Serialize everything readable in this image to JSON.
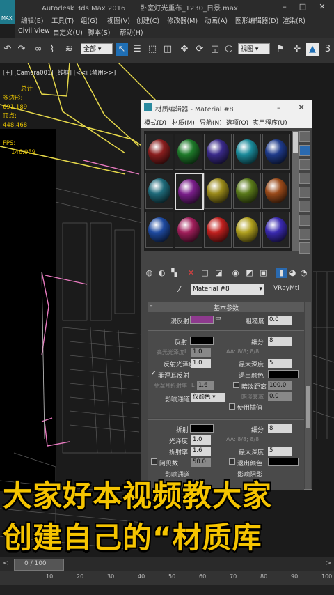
{
  "window": {
    "app_title": "Autodesk 3ds Max 2016",
    "file_title": "卧室灯光重布_1230_日景.max",
    "logo_label": "MAX"
  },
  "menubar": {
    "row1": [
      "编辑(E)",
      "工具(T)",
      "组(G)",
      "视图(V)",
      "创建(C)",
      "修改器(M)",
      "动画(A)",
      "图形编辑器(D)",
      "渲染(R)"
    ],
    "row2": [
      "Civil View",
      "自定义(U)",
      "脚本(S)",
      "帮助(H)"
    ]
  },
  "toolbar": {
    "selection_filter": "全部",
    "view_dropdown": "视图"
  },
  "viewport": {
    "label": "[+] [Camera001] [线框] [<<已禁用>>]",
    "stats_header": "总计",
    "polys_label": "多边形:",
    "polys_value": "691,189",
    "verts_label": "顶点:",
    "verts_value": "448,468",
    "fps_label": "FPS:",
    "fps_value": "146.059"
  },
  "material_editor": {
    "title": "材质编辑器 - Material #8",
    "menu": [
      "模式(D)",
      "材质(M)",
      "导航(N)",
      "选项(O)",
      "实用程序(U)"
    ],
    "slot_colors": [
      [
        "#8a1e1e",
        "#1e7a2a",
        "#3a2a8a",
        "#1a8a9a",
        "#1e3a8a"
      ],
      [
        "#1e6a7a",
        "#7a1e8a",
        "#9a8a1a",
        "#5a7a1a",
        "#9a4a1a"
      ],
      [
        "#1e4aa0",
        "#a01e5a",
        "#c0201e",
        "#b0a01e",
        "#3a2ab0"
      ]
    ],
    "material_name": "Material #8",
    "material_type": "VRayMtl",
    "rollout_title": "基本参数",
    "diffuse_label": "漫反射",
    "diffuse_color": "#8e3a8e",
    "roughness_label": "粗糙度",
    "roughness_value": "0.0",
    "reflect_label": "反射",
    "subdivs_label": "细分",
    "reflect_subdivs": "8",
    "hilight_gloss_label": "高光光泽度",
    "hilight_gloss_value": "1.0",
    "aa_label": "AA: 8/8; 8/8",
    "reflect_gloss_label": "反射光泽度",
    "reflect_gloss_value": "1.0",
    "max_depth_label": "最大深度",
    "reflect_max_depth": "5",
    "fresnel_label": "菲涅耳反射",
    "exit_color_label": "退出颜色",
    "fresnel_ior_label": "菲涅耳折射率",
    "fresnel_ior_value": "1.6",
    "dim_distance_label": "暗淡距离",
    "dim_distance_value": "100.0",
    "dim_falloff_label": "暗淡衰减",
    "dim_falloff_value": "0.0",
    "affect_channels_label": "影响通道",
    "affect_channels_value": "仅颜色",
    "use_interp_label": "使用插值",
    "refract_label": "折射",
    "refract_subdivs": "8",
    "gloss_label": "光泽度",
    "refract_gloss_value": "1.0",
    "refract_aa_label": "AA: 8/8; 8/8",
    "ior_label": "折射率",
    "ior_value": "1.6",
    "refract_max_depth": "5",
    "abbe_label": "阿贝数",
    "abbe_value": "50.0",
    "refract_exit_label": "退出颜色",
    "refract_affect_label": "影响通道",
    "shadow_label": "影响阴影"
  },
  "captions": {
    "line1": "大家好本视频教大家",
    "line2": "创建自己的“材质库"
  },
  "timeline": {
    "frame_counter": "0 / 100",
    "ticks": [
      "10",
      "20",
      "30",
      "40",
      "50",
      "60",
      "70",
      "80",
      "90",
      "100"
    ]
  }
}
